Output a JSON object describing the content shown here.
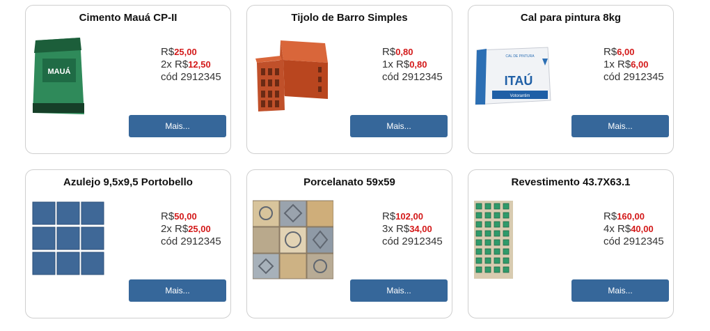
{
  "currency": "R$",
  "cod_prefix": "cód",
  "button_label": "Mais...",
  "products": [
    {
      "title": "Cimento Mauá CP-II",
      "image_icon": "cement-bag-icon",
      "price": "25,00",
      "installments_prefix": "2x",
      "installment_value": "12,50",
      "code": "2912345",
      "bag_brand": "MAUÁ"
    },
    {
      "title": "Tijolo de Barro Simples",
      "image_icon": "clay-brick-icon",
      "price": "0,80",
      "installments_prefix": "1x",
      "installment_value": "0,80",
      "code": "2912345"
    },
    {
      "title": "Cal para pintura 8kg",
      "image_icon": "lime-bag-icon",
      "price": "6,00",
      "installments_prefix": "1x",
      "installment_value": "6,00",
      "code": "2912345",
      "bag_brand": "ITAÚ",
      "bag_label": "CAL DE PINTURA",
      "bag_footer": "Votorantim"
    },
    {
      "title": "Azulejo 9,5x9,5 Portobello",
      "image_icon": "blue-tiles-icon",
      "price": "50,00",
      "installments_prefix": "2x",
      "installment_value": "25,00",
      "code": "2912345"
    },
    {
      "title": "Porcelanato 59x59",
      "image_icon": "patterned-tiles-icon",
      "price": "102,00",
      "installments_prefix": "3x",
      "installment_value": "34,00",
      "code": "2912345"
    },
    {
      "title": "Revestimento 43.7X63.1",
      "image_icon": "mosaic-tile-icon",
      "price": "160,00",
      "installments_prefix": "4x",
      "installment_value": "40,00",
      "code": "2912345"
    }
  ],
  "colors": {
    "button": "#36679a",
    "price": "#d31919",
    "border": "#cfcfcf"
  }
}
